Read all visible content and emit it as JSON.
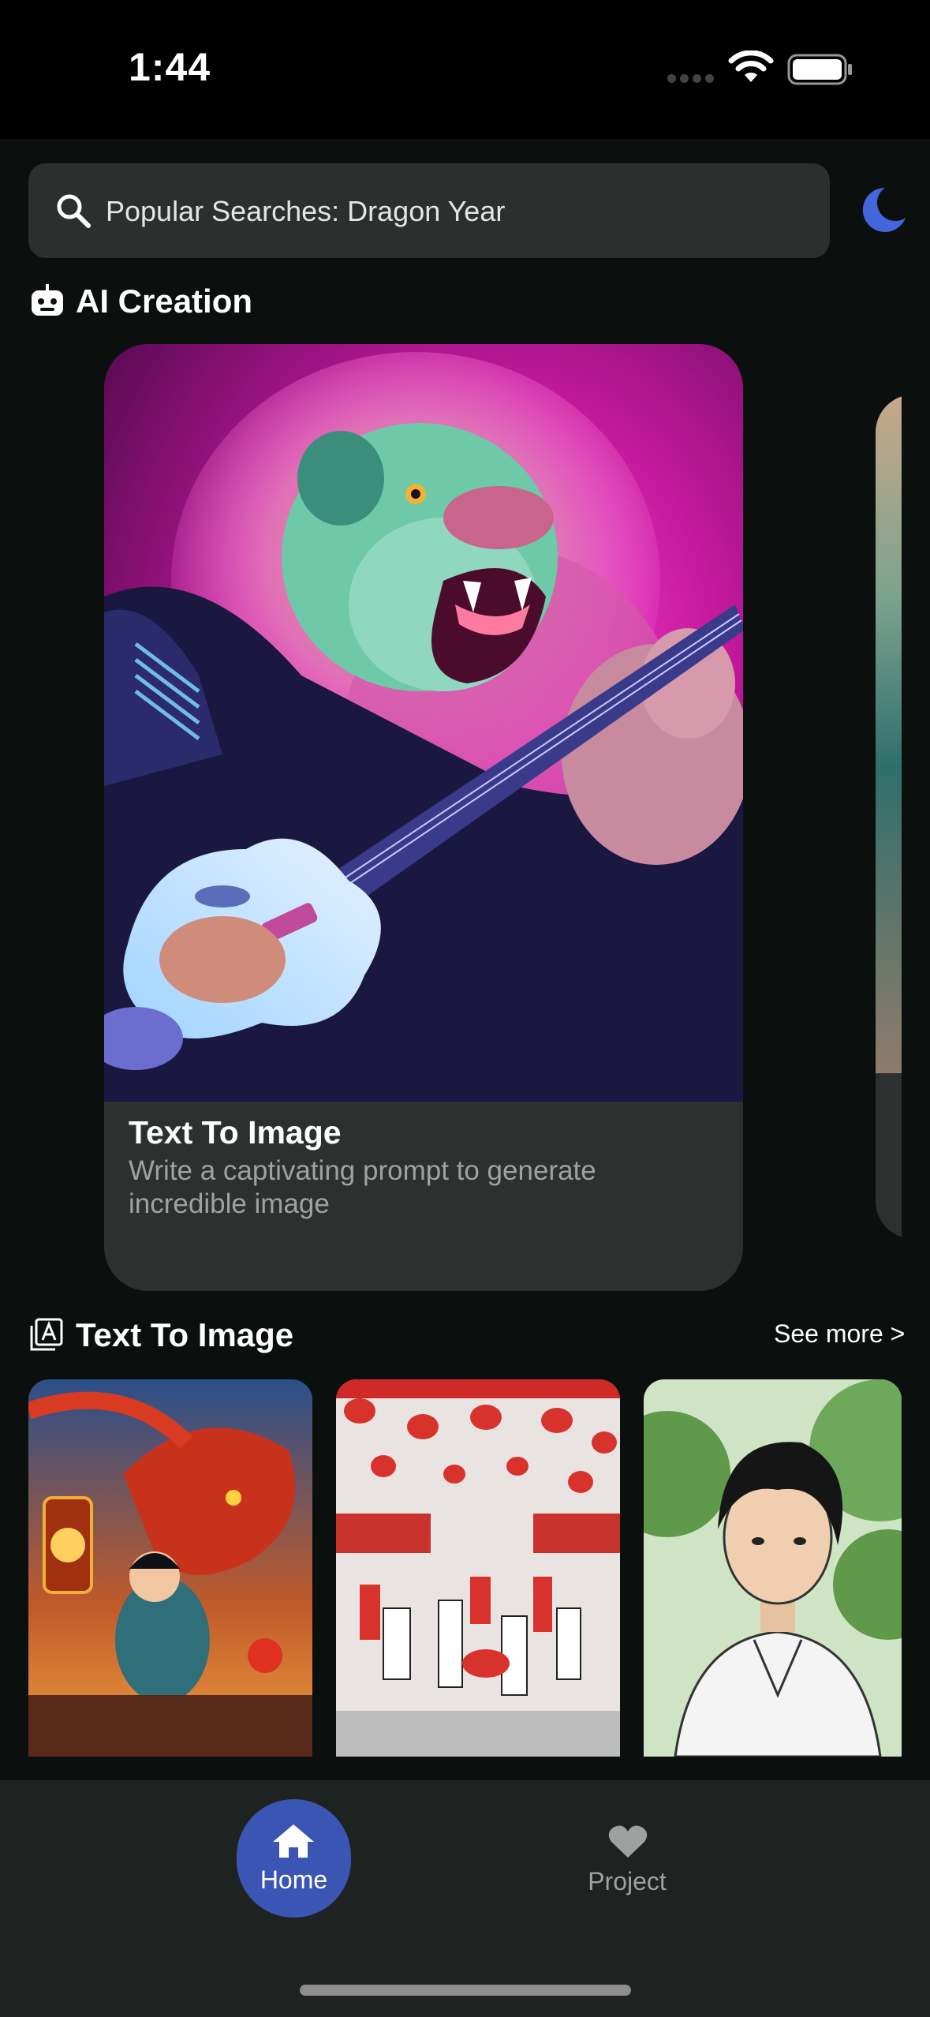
{
  "status": {
    "time": "1:44"
  },
  "search": {
    "text": "Popular Searches: Dragon Year"
  },
  "sections": {
    "ai_creation": {
      "title": "AI Creation"
    },
    "text_to_image": {
      "title": "Text To Image",
      "see_more": "See more >"
    }
  },
  "featured_card": {
    "title": "Text To Image",
    "description": "Write a captivating prompt to generate incredible image"
  },
  "nav": {
    "home_label": "Home",
    "project_label": "Project"
  },
  "colors": {
    "background": "#0b0f0d",
    "accent": "#3a55b4",
    "moon": "#4466dd",
    "card": "#2c302f"
  },
  "icons": {
    "search": "search-icon",
    "moon": "moon-icon",
    "robot": "robot-icon",
    "text_image": "text-image-icon",
    "home": "home-icon",
    "heart": "heart-icon"
  }
}
